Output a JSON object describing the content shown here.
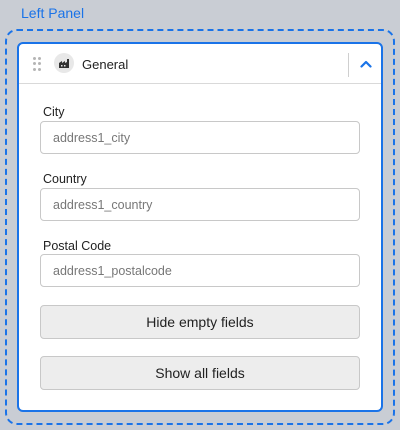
{
  "panel": {
    "title": "Left Panel"
  },
  "section": {
    "title": "General",
    "icon": "factory-icon",
    "collapse_icon": "chevron-up-icon",
    "accent": "#1a73e8"
  },
  "fields": [
    {
      "label": "City",
      "placeholder": "address1_city"
    },
    {
      "label": "Country",
      "placeholder": "address1_country"
    },
    {
      "label": "Postal Code",
      "placeholder": "address1_postalcode"
    }
  ],
  "buttons": {
    "hide_empty": "Hide empty fields",
    "show_all": "Show all fields"
  }
}
